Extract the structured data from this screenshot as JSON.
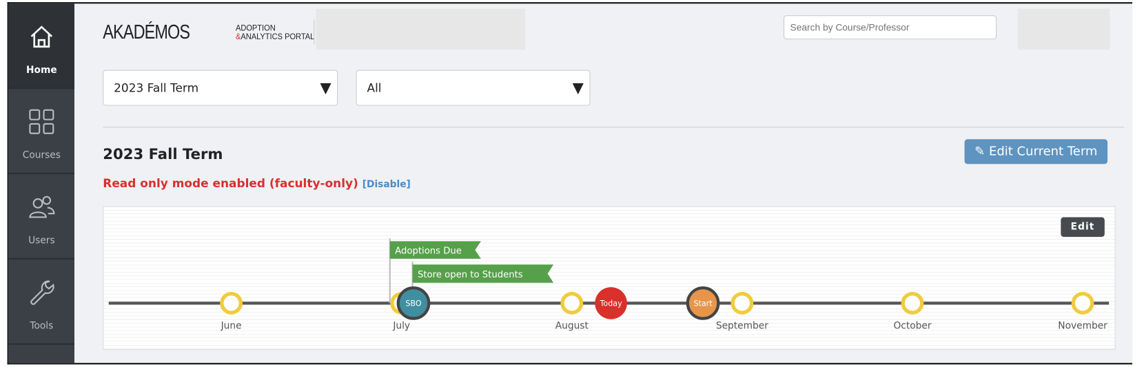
{
  "sidebar": {
    "items": [
      {
        "label": "Home",
        "icon": "home-icon",
        "active": true
      },
      {
        "label": "Courses",
        "icon": "grid-icon"
      },
      {
        "label": "Users",
        "icon": "users-icon"
      },
      {
        "label": "Tools",
        "icon": "wrench-icon"
      }
    ]
  },
  "header": {
    "logo_main": "AKADÉMOS",
    "logo_line1": "ADOPTION",
    "logo_amp": "&",
    "logo_line2": "ANALYTICS PORTAL",
    "search_placeholder": "Search by Course/Professor"
  },
  "filters": {
    "term": "2023 Fall Term",
    "scope": "All"
  },
  "term": {
    "title": "2023 Fall Term",
    "edit_label": "Edit Current Term",
    "readonly_text": "Read only mode enabled (faculty-only)",
    "disable_label": "[Disable]"
  },
  "timeline": {
    "edit_label": "Edit",
    "months": [
      "June",
      "July",
      "August",
      "September",
      "October",
      "November"
    ],
    "events": [
      {
        "label": "SBO",
        "color": "#3f8fa0",
        "month_position": 1.07
      },
      {
        "label": "Today",
        "color": "#d9302c",
        "month_position": 2.23
      },
      {
        "label": "Start",
        "color": "#e8954a",
        "month_position": 2.77
      }
    ],
    "flags": [
      {
        "label": "Adoptions Due",
        "color": "#56a04a"
      },
      {
        "label": "Store open to Students",
        "color": "#56a04a"
      }
    ],
    "colors": {
      "month_ring": "#f0cc3c",
      "line": "#555555"
    }
  }
}
